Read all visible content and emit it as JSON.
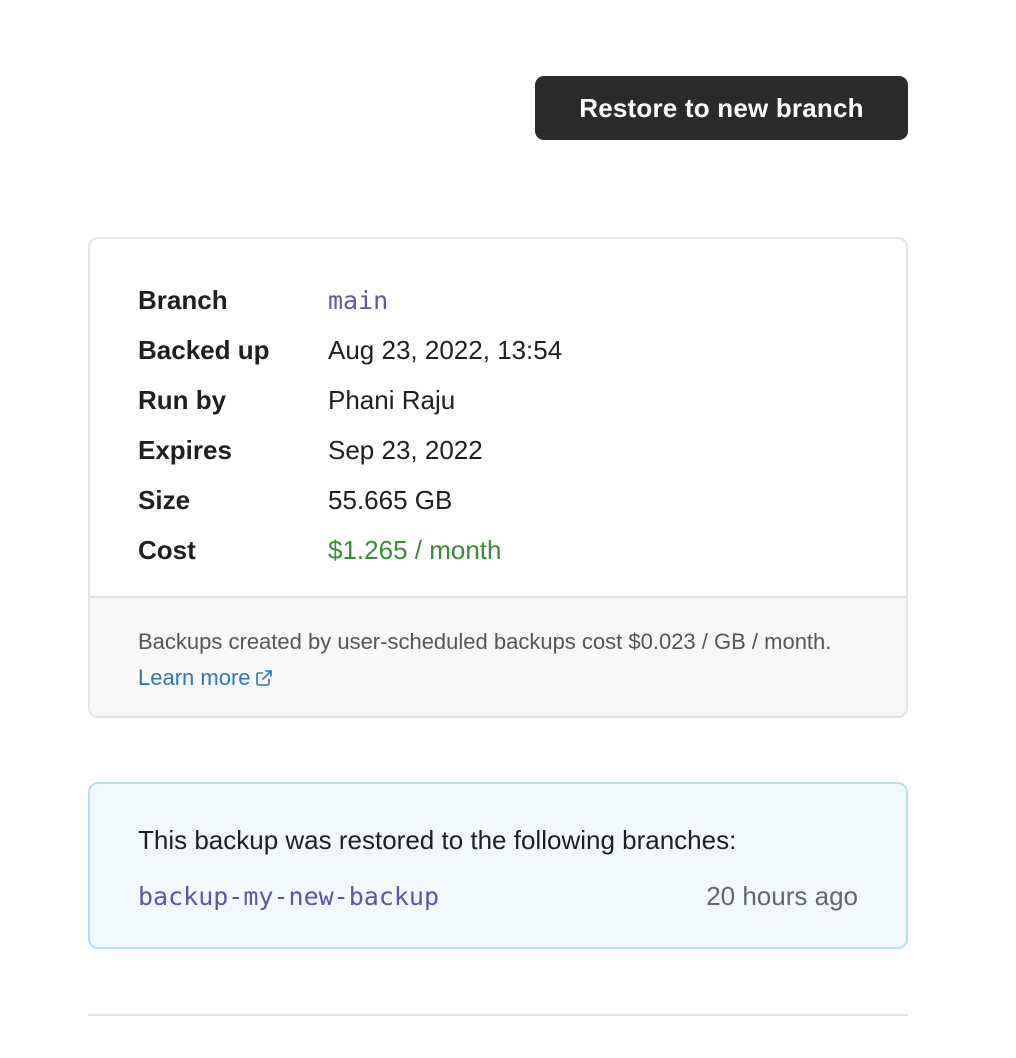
{
  "actions": {
    "restore_label": "Restore to new branch"
  },
  "details": {
    "rows": [
      {
        "label": "Branch",
        "value": "main"
      },
      {
        "label": "Backed up",
        "value": "Aug 23, 2022, 13:54"
      },
      {
        "label": "Run by",
        "value": "Phani Raju"
      },
      {
        "label": "Expires",
        "value": "Sep 23, 2022"
      },
      {
        "label": "Size",
        "value": "55.665 GB"
      },
      {
        "label": "Cost",
        "value": "$1.265 / month"
      }
    ],
    "footer_text": "Backups created by user-scheduled backups cost $0.023 / GB / month.",
    "learn_more_label": "Learn more",
    "learn_more_icon": "external-link-icon"
  },
  "restored": {
    "heading": "This backup was restored to the following branches:",
    "branches": [
      {
        "name": "backup-my-new-backup",
        "time": "20 hours ago"
      }
    ]
  },
  "colors": {
    "button_bg": "#2b2b2b",
    "mono_accent": "#5e53a6",
    "cost_green": "#3a8a3a",
    "link_blue": "#2f74c0",
    "info_bg": "#f1f9fd",
    "info_border": "#b9dff2"
  }
}
